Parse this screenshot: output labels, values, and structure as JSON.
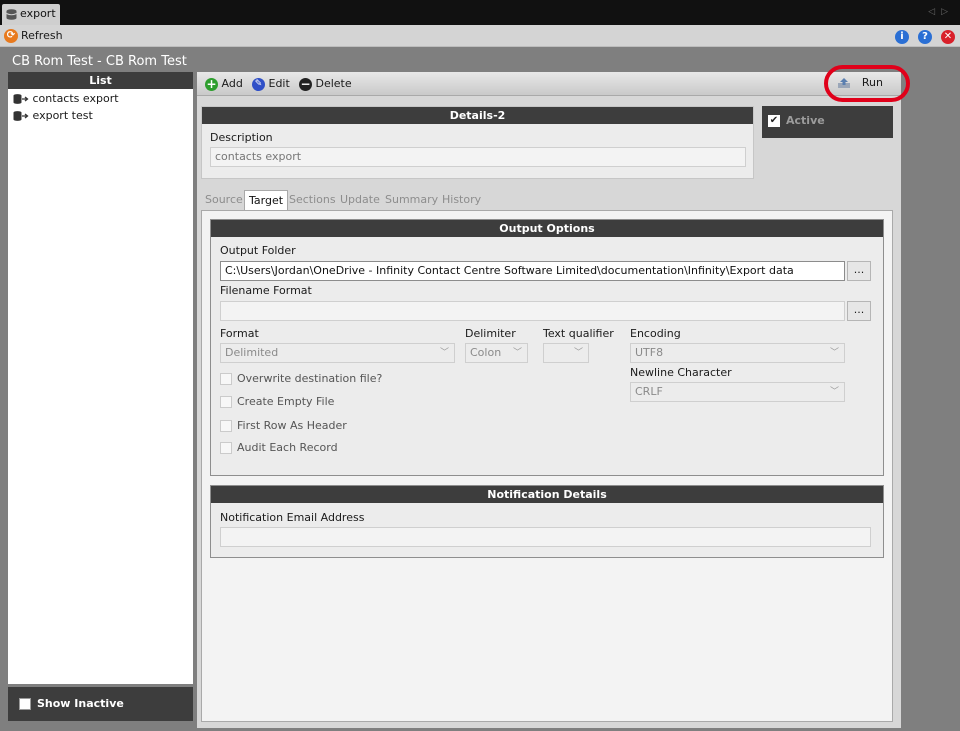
{
  "window": {
    "tab_title": "export"
  },
  "toolbar_top": {
    "refresh_label": "Refresh"
  },
  "page": {
    "title": "CB Rom Test - CB Rom Test"
  },
  "list": {
    "header": "List",
    "items": [
      {
        "label": "contacts export"
      },
      {
        "label": "export test"
      }
    ],
    "show_inactive_label": "Show Inactive"
  },
  "actions": {
    "add": "Add",
    "edit": "Edit",
    "delete": "Delete",
    "run": "Run"
  },
  "details": {
    "header": "Details-2",
    "description_label": "Description",
    "description_value": "contacts export",
    "active_label": "Active",
    "active_checked": true
  },
  "tabs": [
    {
      "label": "Source",
      "selected": false
    },
    {
      "label": "Target",
      "selected": true
    },
    {
      "label": "Sections",
      "selected": false
    },
    {
      "label": "Update",
      "selected": false
    },
    {
      "label": "Summary",
      "selected": false
    },
    {
      "label": "History",
      "selected": false
    }
  ],
  "output": {
    "header": "Output Options",
    "folder_label": "Output Folder",
    "folder_value": "C:\\Users\\Jordan\\OneDrive - Infinity Contact Centre Software Limited\\documentation\\Infinity\\Export data",
    "browse_label": "...",
    "filename_label": "Filename Format",
    "filename_value": "",
    "format_label": "Format",
    "format_value": "Delimited",
    "delimiter_label": "Delimiter",
    "delimiter_value": "Colon",
    "qualifier_label": "Text qualifier",
    "qualifier_value": "",
    "encoding_label": "Encoding",
    "encoding_value": "UTF8",
    "newline_label": "Newline Character",
    "newline_value": "CRLF",
    "checkboxes": [
      {
        "label": "Overwrite destination file?",
        "checked": false
      },
      {
        "label": "Create Empty File",
        "checked": false
      },
      {
        "label": "First Row As Header",
        "checked": false
      },
      {
        "label": "Audit Each Record",
        "checked": false
      }
    ]
  },
  "notification": {
    "header": "Notification Details",
    "email_label": "Notification Email Address",
    "email_value": ""
  },
  "colors": {
    "run_highlight": "#e0001a",
    "header_dark": "#3d3d3d",
    "add_green": "#2e9e2e",
    "edit_blue": "#2f4fc7",
    "close_red": "#d8202a",
    "info_blue": "#2a6fd4"
  }
}
